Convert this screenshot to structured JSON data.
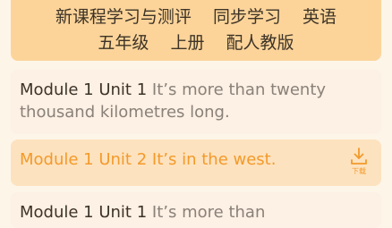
{
  "header": {
    "line1": [
      "新课程学习与测评",
      "同步学习",
      "英语"
    ],
    "line2": [
      "五年级",
      "上册",
      "配人教版"
    ]
  },
  "items": [
    {
      "module": "Module 1 Unit 1",
      "title": "It’s more than twenty thousand kilometres long."
    },
    {
      "module": "Module 1 Unit 2",
      "title": "It’s in the west.",
      "download_label": "下载",
      "icon": "download-icon"
    },
    {
      "module": "Module 1 Unit 1",
      "title": "It’s more than"
    }
  ],
  "colors": {
    "header_bg": "#fcd49a",
    "accent": "#f39a2a",
    "card_bg": "#fdf0e4",
    "active_bg": "#fde2bf"
  }
}
